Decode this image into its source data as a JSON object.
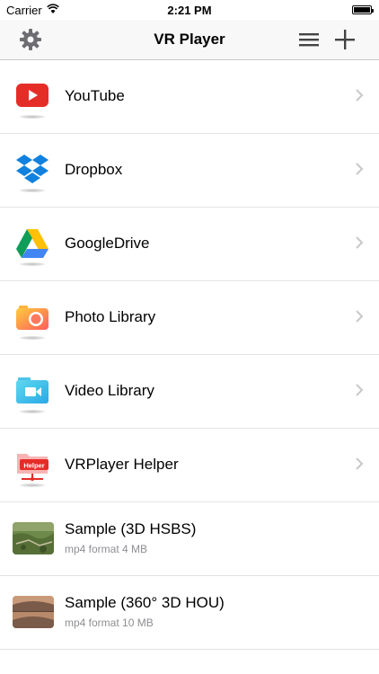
{
  "status_bar": {
    "carrier": "Carrier",
    "time": "2:21 PM"
  },
  "nav": {
    "title": "VR Player"
  },
  "sources": [
    {
      "label": "YouTube",
      "icon": "youtube-icon"
    },
    {
      "label": "Dropbox",
      "icon": "dropbox-icon"
    },
    {
      "label": "GoogleDrive",
      "icon": "google-drive-icon"
    },
    {
      "label": "Photo Library",
      "icon": "camera-icon"
    },
    {
      "label": "Video Library",
      "icon": "video-camera-icon"
    },
    {
      "label": "VRPlayer Helper",
      "icon": "helper-folder-icon",
      "badge": "Helper"
    }
  ],
  "videos": [
    {
      "title": "Sample (3D HSBS)",
      "meta": "mp4 format 4 MB"
    },
    {
      "title": "Sample (360° 3D HOU)",
      "meta": "mp4 format 10 MB"
    }
  ]
}
